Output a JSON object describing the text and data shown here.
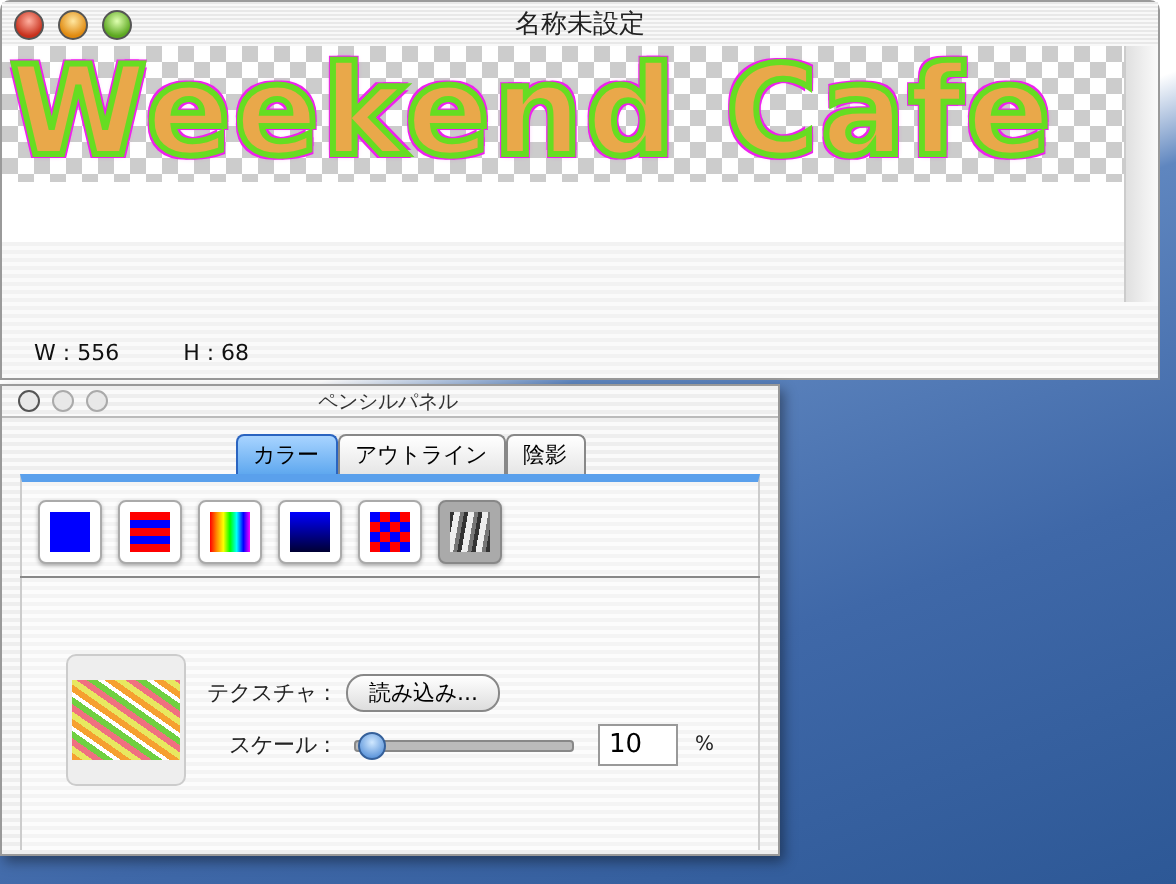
{
  "document_window": {
    "title": "名称未設定",
    "canvas_text": "Weekend Cafe",
    "status": [
      {
        "label": "W : 556"
      },
      {
        "label": "H : 68"
      }
    ]
  },
  "palette": {
    "title": "ペンシルパネル",
    "tabs": [
      {
        "label": "カラー",
        "selected": true
      },
      {
        "label": "アウトライン",
        "selected": false
      },
      {
        "label": "陰影",
        "selected": false
      }
    ],
    "swatches": [
      {
        "kind": "solid",
        "selected": false
      },
      {
        "kind": "stripes",
        "selected": false
      },
      {
        "kind": "rainbow",
        "selected": false
      },
      {
        "kind": "gradient",
        "selected": false
      },
      {
        "kind": "checker",
        "selected": false
      },
      {
        "kind": "texture",
        "selected": true
      }
    ],
    "texture_label": "テクスチャ :",
    "load_button": "読み込み...",
    "scale_label": "スケール :",
    "scale": {
      "level": 0.03
    },
    "scale_value": "10",
    "unit": "%"
  }
}
